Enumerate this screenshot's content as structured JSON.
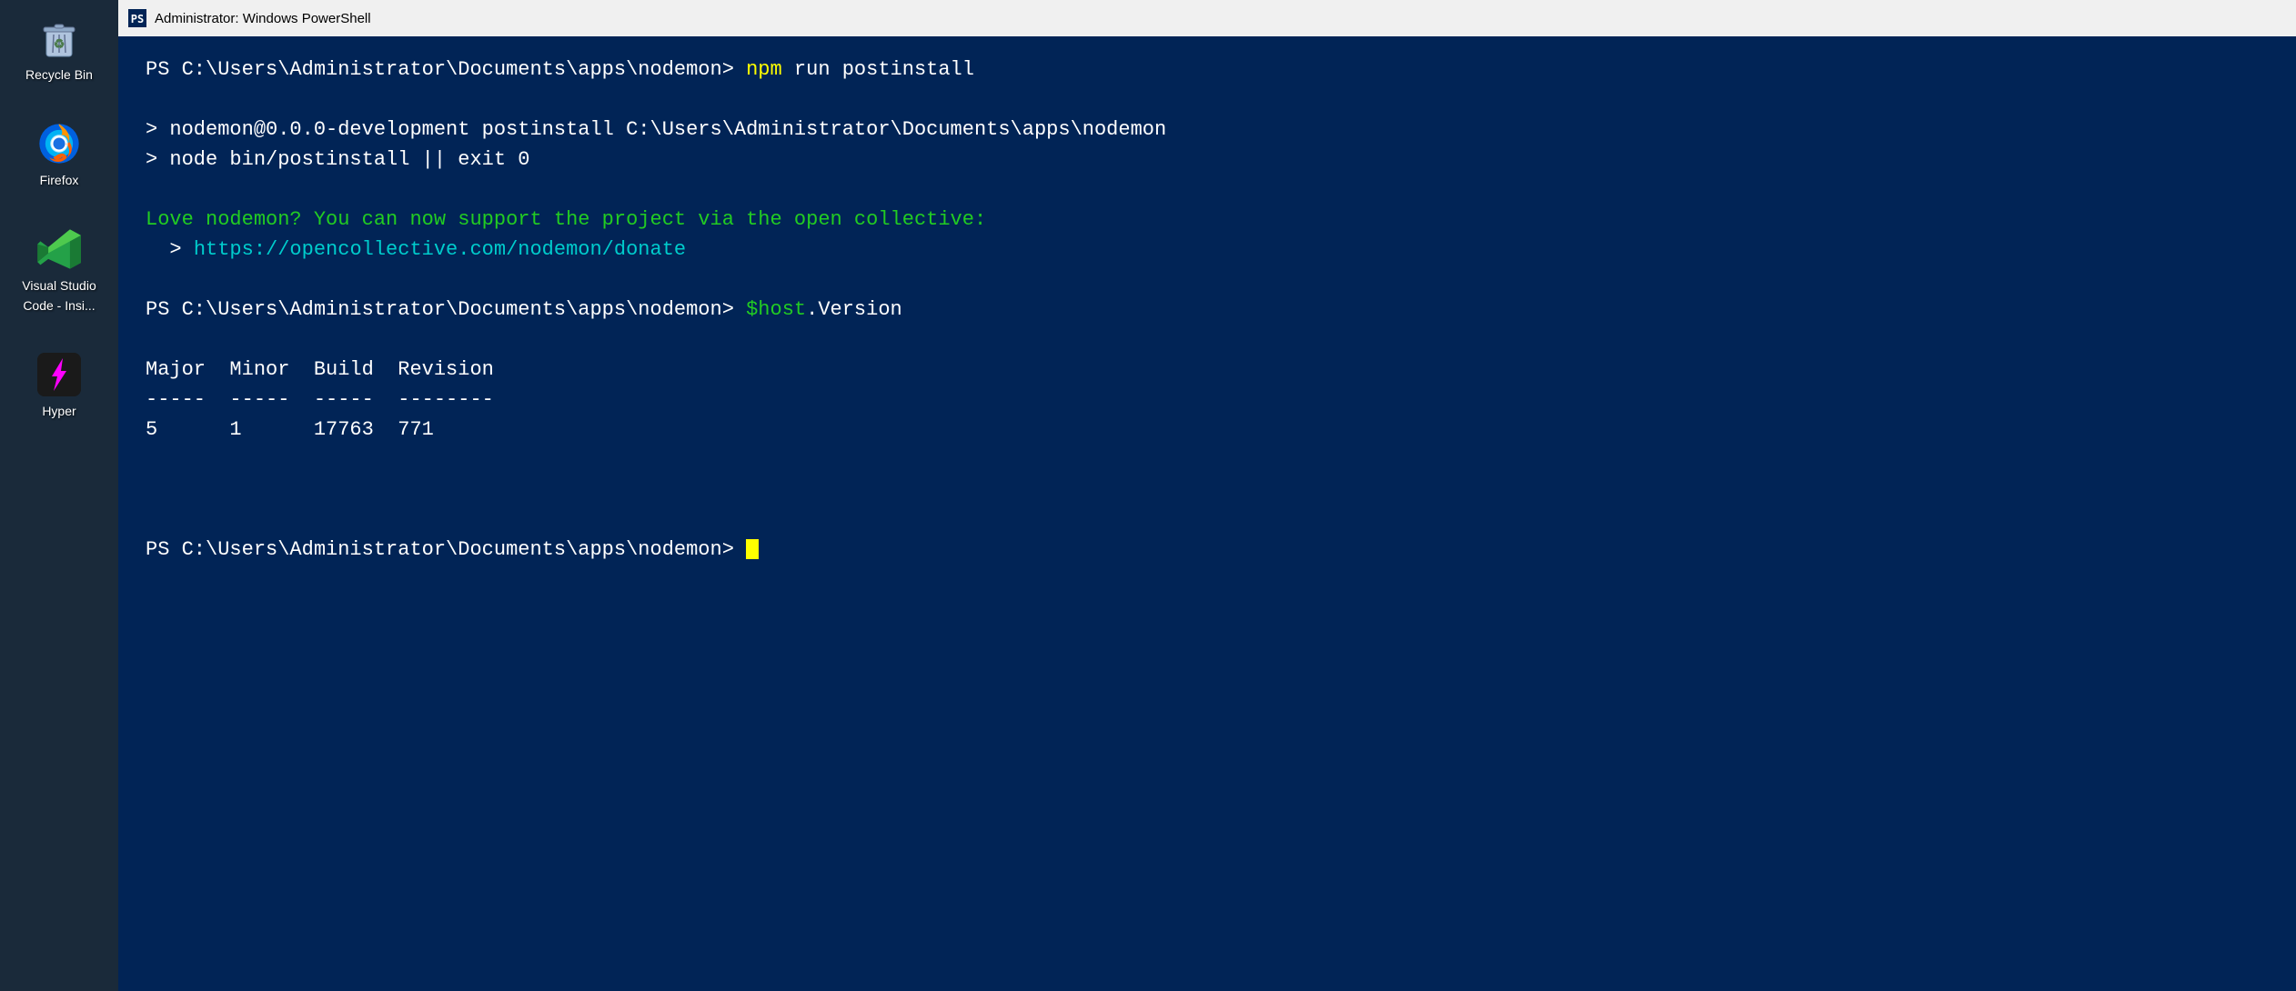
{
  "desktop": {
    "background_color": "#1a2a3a",
    "icons": [
      {
        "id": "recycle-bin",
        "label": "Recycle Bin",
        "label_line2": ""
      },
      {
        "id": "firefox",
        "label": "Firefox",
        "label_line2": ""
      },
      {
        "id": "vscode",
        "label": "Visual Studio",
        "label_line2": "Code - Insi..."
      },
      {
        "id": "hyper",
        "label": "Hyper",
        "label_line2": ""
      }
    ]
  },
  "titlebar": {
    "title": "Administrator: Windows PowerShell"
  },
  "terminal": {
    "lines": [
      {
        "type": "prompt-command",
        "prompt": "PS C:\\Users\\Administrator\\Documents\\apps\\nodemon>",
        "command_prefix": " ",
        "npm": "npm",
        "command_rest": " run postinstall"
      },
      {
        "type": "blank"
      },
      {
        "type": "output",
        "text": "> nodemon@0.0.0-development postinstall C:\\Users\\Administrator\\Documents\\apps\\nodemon"
      },
      {
        "type": "output",
        "text": "> node bin/postinstall || exit 0"
      },
      {
        "type": "blank"
      },
      {
        "type": "green-message",
        "text": "Love nodemon? You can now support the project via the open collective:"
      },
      {
        "type": "link-line",
        "prefix": "  > ",
        "link": "https://opencollective.com/nodemon/donate"
      },
      {
        "type": "blank"
      },
      {
        "type": "prompt-command",
        "prompt": "PS C:\\Users\\Administrator\\Documents\\apps\\nodemon>",
        "command_prefix": " ",
        "hostvar": "$host",
        "command_rest": ".Version"
      },
      {
        "type": "blank"
      },
      {
        "type": "table-header",
        "cols": [
          "Major",
          "Minor",
          "Build",
          "Revision"
        ]
      },
      {
        "type": "table-sep",
        "cols": [
          "-----",
          "-----",
          "-----",
          "--------"
        ]
      },
      {
        "type": "table-row",
        "cols": [
          "5",
          "1",
          "17763",
          "771"
        ]
      },
      {
        "type": "blank"
      },
      {
        "type": "blank"
      },
      {
        "type": "blank"
      },
      {
        "type": "prompt-cursor",
        "prompt": "PS C:\\Users\\Administrator\\Documents\\apps\\nodemon>"
      }
    ]
  }
}
